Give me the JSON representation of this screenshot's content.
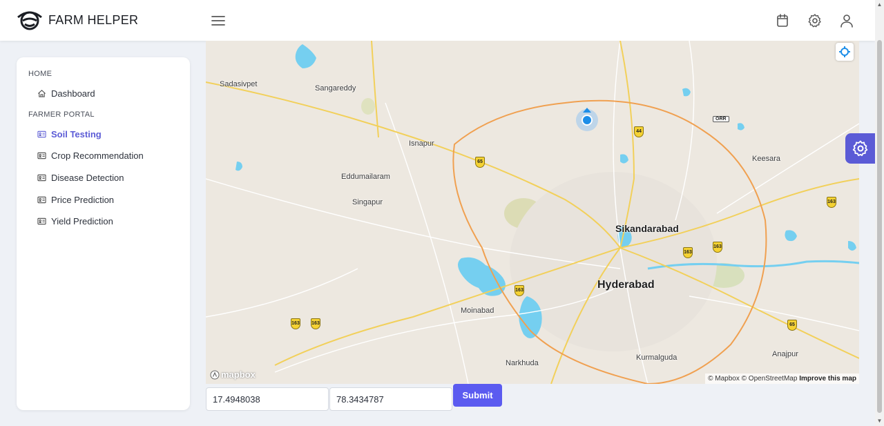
{
  "app": {
    "title": "FARM HELPER"
  },
  "header": {
    "icons": [
      "menu-icon",
      "calendar-icon",
      "gear-icon",
      "user-icon"
    ]
  },
  "sidebar": {
    "sections": [
      {
        "title": "HOME",
        "items": [
          {
            "label": "Dashboard",
            "icon": "home-icon"
          }
        ]
      },
      {
        "title": "FARMER PORTAL",
        "items": [
          {
            "label": "Soil Testing",
            "icon": "id-card-icon",
            "active": true
          },
          {
            "label": "Crop Recommendation",
            "icon": "id-card-icon"
          },
          {
            "label": "Disease Detection",
            "icon": "id-card-icon"
          },
          {
            "label": "Price Prediction",
            "icon": "id-card-icon"
          },
          {
            "label": "Yield Prediction",
            "icon": "id-card-icon"
          }
        ]
      }
    ]
  },
  "map": {
    "places": {
      "sadasivpet": "Sadasivpet",
      "sangareddy": "Sangareddy",
      "isnapur": "Isnapur",
      "eddumailaram": "Eddumailaram",
      "singapur": "Singapur",
      "keesara": "Keesara",
      "sikandarabad": "Sikandarabad",
      "hyderabad": "Hyderabad",
      "moinabad": "Moinabad",
      "narkhuda": "Narkhuda",
      "kurmalguda": "Kurmalguda",
      "anajpur": "Anajpur"
    },
    "highway_shields": {
      "nh65a": "65",
      "nh44": "44",
      "nh163a": "163",
      "nh163b": "163",
      "nh163c": "163",
      "nh65b": "163",
      "nh163d": "163",
      "nh163e": "163",
      "nh65c": "65",
      "nh163f": "163"
    },
    "orr": "ORR",
    "logo": "mapbox",
    "attribution": {
      "mapbox": "© Mapbox",
      "osm": "© OpenStreetMap",
      "improve": "Improve this map"
    },
    "colors": {
      "land": "#ede8e0",
      "water": "#75cff0",
      "ring_road": "#f0a050",
      "road": "#f7d774",
      "accent": "#5b5bd6"
    }
  },
  "form": {
    "latitude": "17.4948038",
    "longitude": "78.3434787",
    "submit_label": "Submit"
  },
  "floating": {
    "icon": "gear-icon"
  }
}
